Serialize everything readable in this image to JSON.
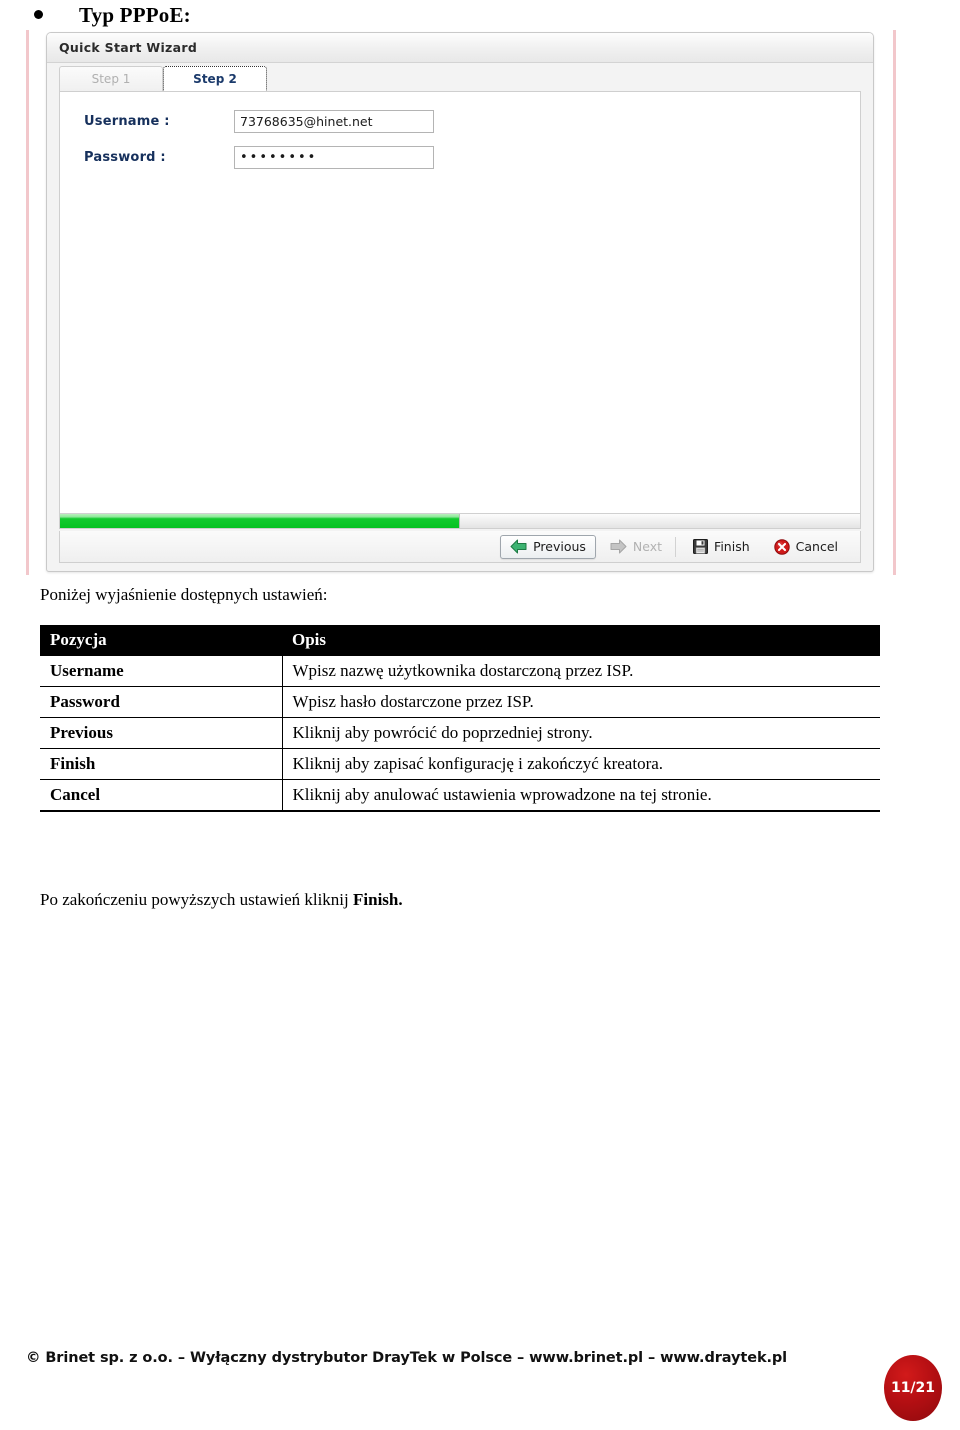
{
  "heading": {
    "bullet": "•",
    "title": "Typ PPPoE:"
  },
  "screenshot": {
    "window_title": "Quick Start Wizard",
    "tabs": [
      {
        "label": "Step 1",
        "state": "inactive"
      },
      {
        "label": "Step 2",
        "state": "active"
      }
    ],
    "form": {
      "username_label": "Username :",
      "username_value": "73768635@hinet.net",
      "password_label": "Password :",
      "password_value": "••••••••"
    },
    "progress": {
      "percent": 50
    },
    "buttons": [
      {
        "label": "Previous",
        "icon": "arrow-left-green-icon",
        "state": "enabled"
      },
      {
        "label": "Next",
        "icon": "arrow-right-gray-icon",
        "state": "disabled"
      },
      {
        "label": "Finish",
        "icon": "floppy-disk-icon",
        "state": "enabled"
      },
      {
        "label": "Cancel",
        "icon": "red-x-circle-icon",
        "state": "enabled"
      }
    ],
    "colors": {
      "progress_green": "#06c222",
      "active_tab_text": "#1b3a6b",
      "label_navy": "#16305c",
      "cancel_red": "#c81515",
      "page_edge_pink": "#f2c7cb"
    }
  },
  "lead_text": "Poniżej wyjaśnienie dostępnych ustawień:",
  "table": {
    "headers": [
      "Pozycja",
      "Opis"
    ],
    "rows": [
      [
        "Username",
        "Wpisz nazwę użytkownika dostarczoną przez ISP."
      ],
      [
        "Password",
        "Wpisz hasło dostarczone przez ISP."
      ],
      [
        "Previous",
        "Kliknij aby powrócić do poprzedniej strony."
      ],
      [
        "Finish",
        "Kliknij aby zapisać konfigurację i zakończyć kreatora."
      ],
      [
        "Cancel",
        "Kliknij aby anulować ustawienia wprowadzone na tej stronie."
      ]
    ]
  },
  "closing": {
    "prefix": "Po zakończeniu powyższych ustawień kliknij ",
    "emphasis": "Finish."
  },
  "footer": {
    "text": "© Brinet sp. z o.o. – Wyłączny dystrybutor DrayTek w Polsce – www.brinet.pl – www.draytek.pl",
    "page": "11/21"
  }
}
